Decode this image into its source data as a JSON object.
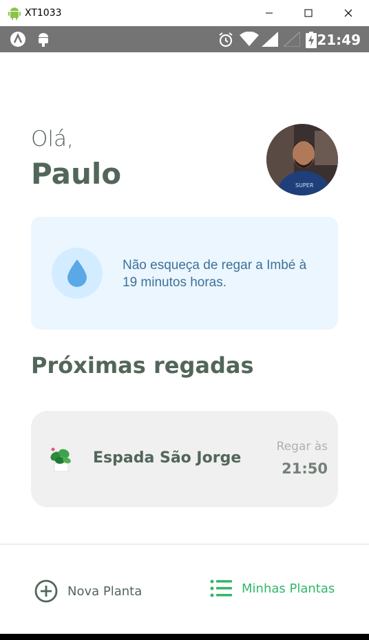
{
  "window": {
    "title": "XT1033",
    "app_icon": "android-icon",
    "controls": [
      "minimize-icon",
      "maximize-icon",
      "close-icon"
    ]
  },
  "status_bar": {
    "time": "21:49",
    "left_icons": [
      "app-a-icon",
      "android-debug-icon"
    ],
    "right_icons": [
      "alarm-icon",
      "wifi-icon",
      "signal-icon",
      "signal-empty-icon",
      "battery-charging-icon"
    ]
  },
  "header": {
    "greeting": "Olá,",
    "user_name": "Paulo"
  },
  "reminder": {
    "icon": "water-drop-icon",
    "text": "Não esqueça de regar a Imbé à 19 minutos horas."
  },
  "next_waterings": {
    "title": "Próximas regadas",
    "items": [
      {
        "icon": "plant-icon",
        "name": "Espada São Jorge",
        "water_label": "Regar às",
        "water_time": "21:50"
      }
    ]
  },
  "bottom_nav": {
    "new_plant": {
      "icon": "plus-circle-icon",
      "label": "Nova Planta"
    },
    "my_plants": {
      "icon": "list-icon",
      "label": "Minhas Plantas"
    }
  },
  "colors": {
    "heading": "#52665A",
    "accent_green": "#32B768",
    "reminder_bg": "#EBF6FF",
    "reminder_text": "#3D7199",
    "card_bg": "#F0F0F0",
    "status_bar": "#747474"
  }
}
